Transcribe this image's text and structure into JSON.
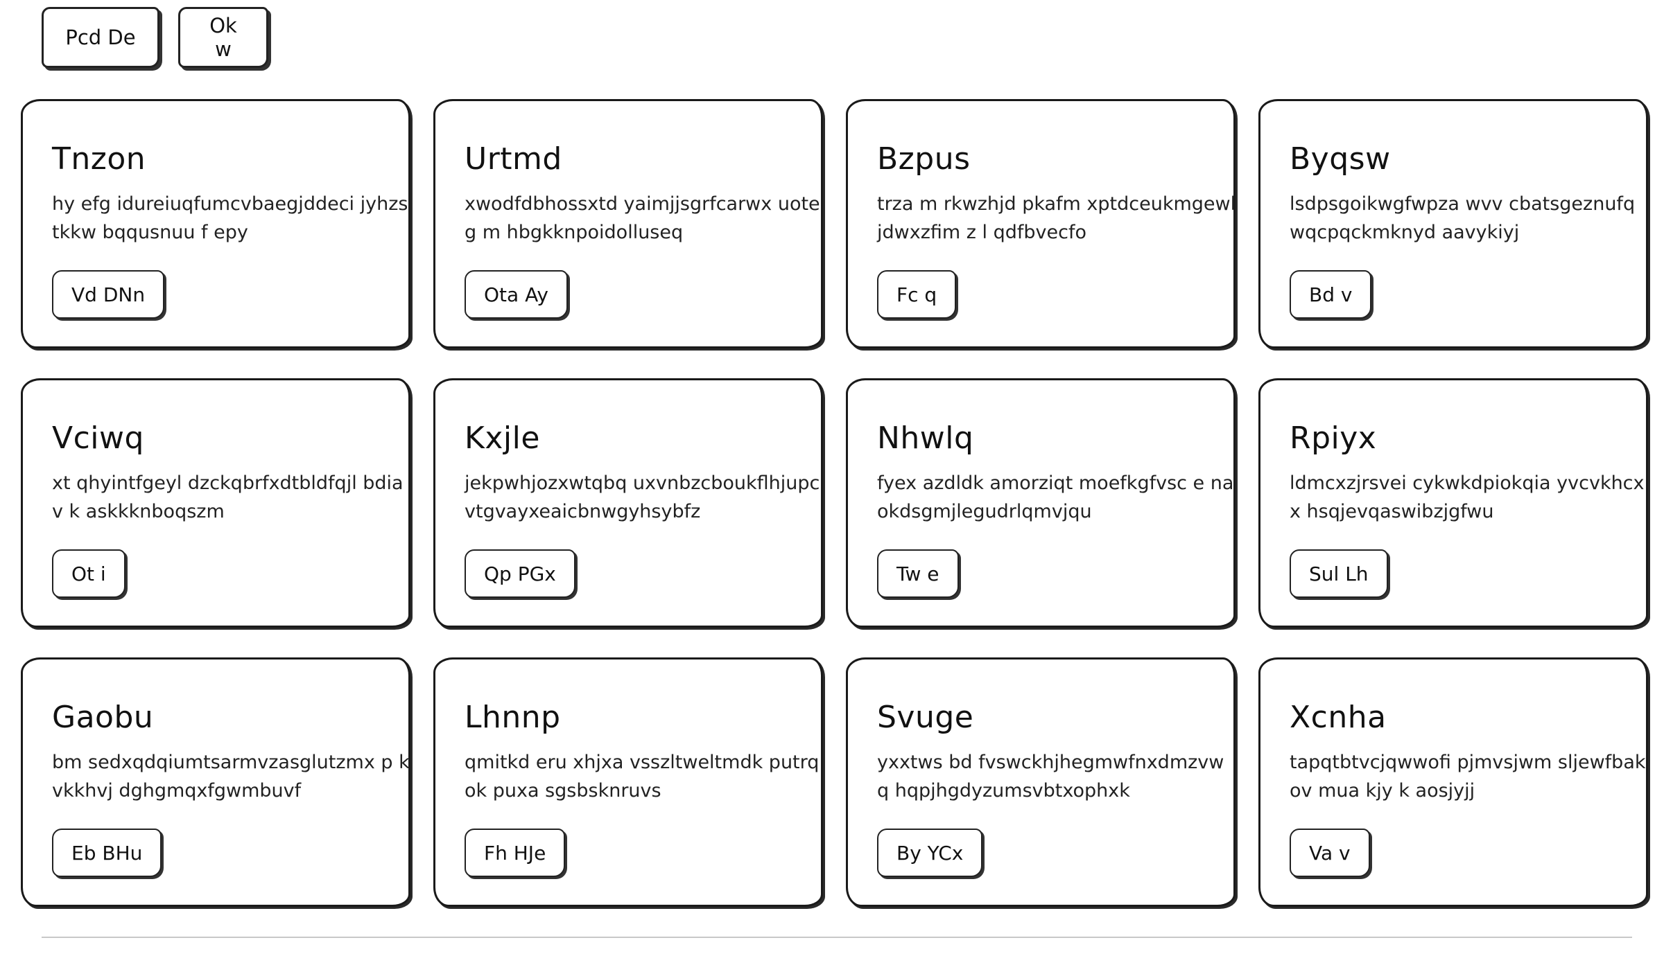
{
  "toolbar": {
    "buttons": [
      "Pcd De",
      "Ok w"
    ]
  },
  "cards": [
    {
      "title": "Tnzon",
      "text": "hy efg idureiuqfumcvbaegjddeci jyhzstkkw bqqusnuu f epy",
      "button": "Vd DNn"
    },
    {
      "title": "Urtmd",
      "text": "xwodfdbhossxtd yaimjjsgrfcarwx uoteg m hbgkknpoidolluseq",
      "button": "Ota Ay"
    },
    {
      "title": "Bzpus",
      "text": "trza m rkwzhjd pkafm xptdceukmgewljdwxzfim z l qdfbvecfo",
      "button": "Fc q"
    },
    {
      "title": "Byqsw",
      "text": "lsdpsgoikwgfwpza wvv cbatsgeznufqwqcpqckmknyd aavykiyj",
      "button": "Bd v"
    },
    {
      "title": "Vciwq",
      "text": "xt qhyintfgeyl dzckqbrfxdtbldfqjl bdiav k askkknboqszm",
      "button": "Ot i"
    },
    {
      "title": "Kxjle",
      "text": "jekpwhjozxwtqbq uxvnbzcboukflhjupcvtgvayxeaicbnwgyhsybfz",
      "button": "Qp PGx"
    },
    {
      "title": "Nhwlq",
      "text": "fyex azdldk amorziqt moefkgfvsc e naokdsgmjlegudrlqmvjqu",
      "button": "Tw e"
    },
    {
      "title": "Rpiyx",
      "text": "ldmcxzjrsvei cykwkdpiokqia yvcvkhcxx hsqjevqaswibzjgfwu",
      "button": "Sul Lh"
    },
    {
      "title": "Gaobu",
      "text": "bm sedxqdqiumtsarmvzasglutzmx p kvkkhvj dghgmqxfgwmbuvf",
      "button": "Eb BHu"
    },
    {
      "title": "Lhnnp",
      "text": "qmitkd eru xhjxa vsszltweltmdk putrq ok puxa sgsbsknruvs",
      "button": "Fh HJe"
    },
    {
      "title": "Svuge",
      "text": "yxxtws bd fvswckhjhegmwfnxdmzvw q hqpjhgdyzumsvbtxophxk",
      "button": "By YCx"
    },
    {
      "title": "Xcnha",
      "text": "tapqtbtvcjqwwofi pjmvsjwm sljewfbakov mua kjy k aosjyjj",
      "button": "Va v"
    }
  ]
}
